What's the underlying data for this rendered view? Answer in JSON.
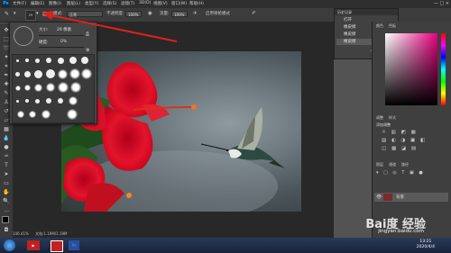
{
  "app": {
    "logo": "Ps"
  },
  "menubar": {
    "items": [
      "文件(F)",
      "编辑(E)",
      "图像(I)",
      "图层(L)",
      "类型(Y)",
      "选择(S)",
      "滤镜(T)",
      "3D(D)",
      "视图(V)",
      "窗口(W)",
      "帮助(H)"
    ]
  },
  "window_controls": "—  □  ×",
  "options_bar": {
    "mode_label": "模式:",
    "mode_value": "正常",
    "opacity_label": "不透明度:",
    "opacity_value": "100%",
    "flow_label": "流量:",
    "flow_value": "100%",
    "airbrush_label": "启用喷枪模式",
    "brush_size_value": "29"
  },
  "brush_panel": {
    "size_label": "大小:",
    "size_value": "29 像素",
    "hardness_label": "硬度:",
    "hardness_value": "0%"
  },
  "history_panel": {
    "title": "历史记录",
    "items": [
      "打开",
      "橡皮擦",
      "橡皮擦",
      "橡皮擦"
    ]
  },
  "right_dock": {
    "color_tabs": [
      "颜色",
      "色板"
    ],
    "adjust_tabs": [
      "调整",
      "样式"
    ],
    "adjust_title": "添加调整",
    "layers_tabs": [
      "图层",
      "通道",
      "路径"
    ],
    "layer_name": "背景"
  },
  "status_bar": {
    "zoom": "146.41%",
    "doc": "文档:1.19M/1.19M"
  },
  "taskbar": {
    "time": "13:21",
    "date": "2020/4/4"
  },
  "watermark": {
    "logo_text": "Bai度 经验",
    "url": "jingyan.baidu.com"
  },
  "colors": {
    "arrow": "#e0201b",
    "panel": "#454545",
    "dock": "#3f3f3f",
    "accent": "#3aa0ff"
  }
}
